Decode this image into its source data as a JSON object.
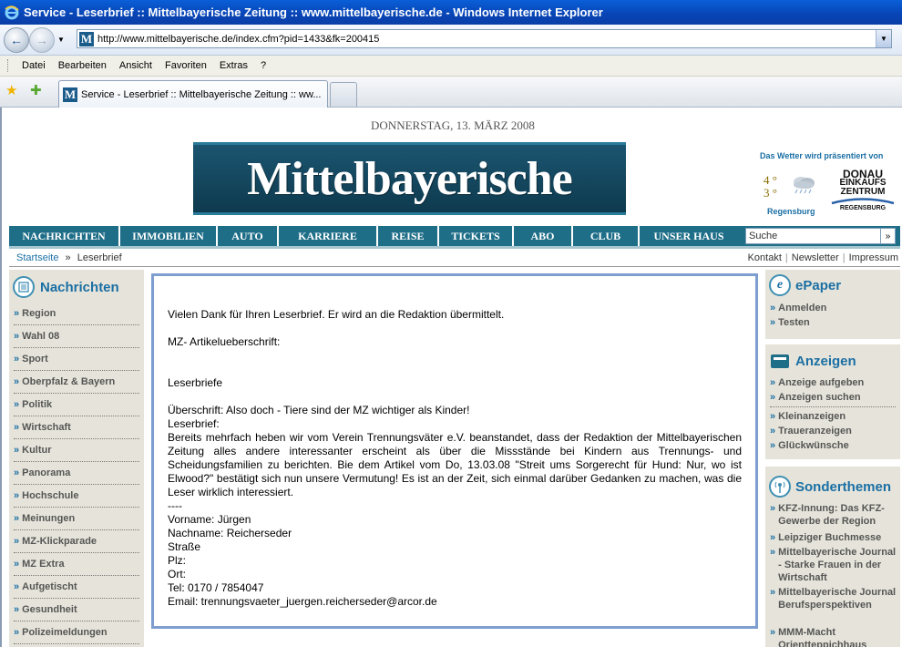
{
  "window": {
    "title": "Service - Leserbrief :: Mittelbayerische Zeitung :: www.mittelbayerische.de - Windows Internet Explorer"
  },
  "address": {
    "url": "http://www.mittelbayerische.de/index.cfm?pid=1433&fk=200415"
  },
  "menu": [
    "Datei",
    "Bearbeiten",
    "Ansicht",
    "Favoriten",
    "Extras",
    "?"
  ],
  "tab": {
    "label": "Service - Leserbrief :: Mittelbayerische Zeitung :: ww..."
  },
  "header": {
    "date": "DONNERSTAG, 13. MÄRZ 2008",
    "logo": "Mittelbayerische"
  },
  "weather": {
    "sponsor_text": "Das Wetter wird präsentiert von",
    "temp_high": "4 °",
    "temp_low": "3 °",
    "city": "Regensburg",
    "sponsor_line1": "DONAU",
    "sponsor_line2": "EINKAUFS",
    "sponsor_line3": "ZENTRUM",
    "sponsor_line4": "REGENSBURG"
  },
  "nav": [
    "NACHRICHTEN",
    "IMMOBILIEN",
    "AUTO",
    "KARRIERE",
    "REISE",
    "TICKETS",
    "ABO",
    "CLUB",
    "UNSER HAUS"
  ],
  "search": {
    "placeholder": "Suche",
    "button": "»"
  },
  "breadcrumb": {
    "home": "Startseite",
    "sep": "»",
    "current": "Leserbrief"
  },
  "toplinks": [
    "Kontakt",
    "Newsletter",
    "Impressum"
  ],
  "sidebar": {
    "title": "Nachrichten",
    "items": [
      "Region",
      "Wahl 08",
      "Sport",
      "Oberpfalz & Bayern",
      "Politik",
      "Wirtschaft",
      "Kultur",
      "Panorama",
      "Hochschule",
      "Meinungen",
      "MZ-Klickparade",
      "MZ Extra",
      "Aufgetischt",
      "Gesundheit",
      "Polizeimeldungen"
    ]
  },
  "content": {
    "thanks": "Vielen Dank für Ihren Leserbrief. Er wird an die Redaktion übermittelt.",
    "headline_label": "MZ- Artikelueberschrift:",
    "category": "Leserbriefe",
    "subject": "Überschrift: Also doch - Tiere sind der MZ wichtiger als Kinder!",
    "body_label": "Leserbrief:",
    "body": "Bereits mehrfach heben wir vom Verein Trennungsväter e.V. beanstandet, dass der Redaktion der Mittelbayerischen Zeitung alles andere interessanter erscheint als über die Missstände bei Kindern aus Trennungs- und Scheidungsfamilien zu berichten. Bie dem Artikel vom Do, 13.03.08 \"Streit ums Sorgerecht für Hund: Nur, wo ist Elwood?\" bestätigt sich nun unsere Vermutung! Es ist an der Zeit, sich einmal darüber Gedanken zu machen, was die Leser wirklich interessiert.",
    "divider": "----",
    "firstname": "Vorname: Jürgen",
    "lastname": "Nachname: Reicherseder",
    "street": "Straße",
    "zip": "Plz:",
    "city": "Ort:",
    "phone": "Tel: 0170 / 7854047",
    "email": "Email: trennungsvaeter_juergen.reicherseder@arcor.de"
  },
  "epaper": {
    "title": "ePaper",
    "links": [
      "Anmelden",
      "Testen"
    ]
  },
  "anzeigen": {
    "title": "Anzeigen",
    "links_top": [
      "Anzeige aufgeben",
      "Anzeigen suchen"
    ],
    "links_bottom": [
      "Kleinanzeigen",
      "Traueranzeigen",
      "Glückwünsche"
    ]
  },
  "sonderthemen": {
    "title": "Sonderthemen",
    "links": [
      "KFZ-Innung: Das KFZ-Gewerbe der Region",
      "Leipziger Buchmesse",
      "Mittelbayerische Journal - Starke Frauen in der Wirtschaft",
      "Mittelbayerische Journal Berufsperspektiven",
      "MMM-Macht Orientteppichhaus"
    ]
  },
  "colors": {
    "brand": "#1e6e88",
    "link": "#1b6fa4",
    "sidebar_bg": "#e6e4da",
    "content_border": "#7e9ed0"
  }
}
